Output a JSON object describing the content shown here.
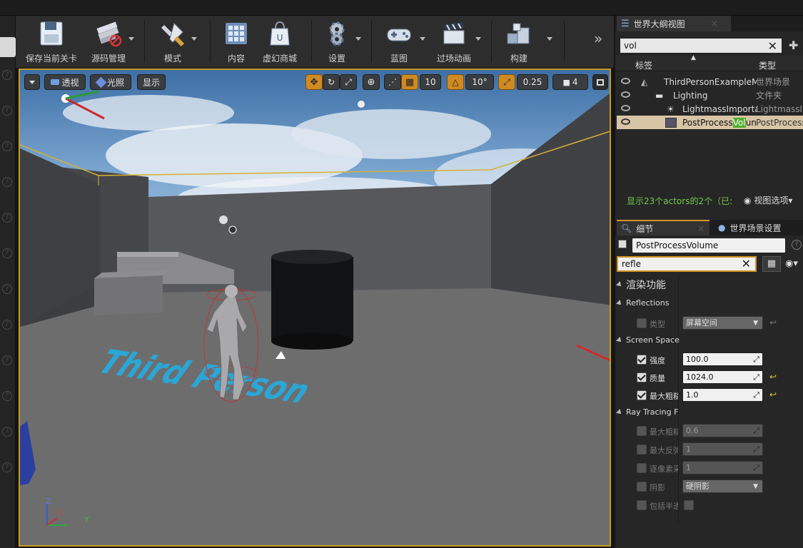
{
  "toolbar": {
    "buttons": [
      {
        "label": "保存当前关卡",
        "icon": "floppy-save-icon"
      },
      {
        "label": "源码管理",
        "icon": "source-control-icon"
      },
      {
        "label": "模式",
        "icon": "modes-tools-icon"
      },
      {
        "label": "内容",
        "icon": "content-grid-icon"
      },
      {
        "label": "虚幻商城",
        "icon": "marketplace-bag-icon"
      },
      {
        "label": "设置",
        "icon": "settings-gear-icon"
      },
      {
        "label": "蓝图",
        "icon": "blueprint-gamepad-icon"
      },
      {
        "label": "过场动画",
        "icon": "cinematics-clapper-icon"
      },
      {
        "label": "构建",
        "icon": "build-cubes-icon"
      }
    ],
    "more": "»"
  },
  "viewport": {
    "perspective_label": "透视",
    "lit_label": "光照",
    "show_label": "显示",
    "grid_snap": "10",
    "rotation_snap": "10°",
    "scale_snap": "0.25",
    "camera_speed": "4",
    "axis_z": "Z",
    "axis_x": "X",
    "axis_y": "Y",
    "floor_text": "Third Person"
  },
  "outliner": {
    "tab_label": "世界大纲视图",
    "search_value": "vol",
    "col_label": "标签",
    "col_type": "类型",
    "rows": [
      {
        "name": "ThirdPersonExampleM",
        "type": "世界场景"
      },
      {
        "name": "Lighting",
        "type": "文件夹"
      },
      {
        "name": "LightmassImporta",
        "type": "LightmassI"
      },
      {
        "name_pre": "PostProcess",
        "name_hl": "Vol",
        "name_post": "un",
        "type": "PostProcess"
      }
    ],
    "status": "显示23个actors的2个（已:",
    "view_options": "视图选项"
  },
  "details": {
    "tab_label": "细节",
    "world_settings_tab": "世界场景设置",
    "actor_name": "PostProcessVolume",
    "search_value": "refle",
    "category": "渲染功能",
    "sections": {
      "reflections": "Reflections",
      "screen_space": "Screen Space",
      "ray_tracing": "Ray Tracing F"
    },
    "props": {
      "type_label": "类型",
      "type_value": "屏幕空间",
      "intensity_label": "强度",
      "intensity_value": "100.0",
      "quality_label": "质量",
      "quality_value": "1024.0",
      "max_rough_label": "最大粗糙",
      "max_rough_value": "1.0",
      "rt_max_rough_label": "最大粗糙",
      "rt_max_rough_value": "0.6",
      "rt_max_bounce_label": "最大反弹",
      "rt_max_bounce_value": "1",
      "rt_spp_label": "逐像素采",
      "rt_spp_value": "1",
      "rt_shadow_label": "阴影",
      "rt_shadow_value": "硬阴影",
      "rt_translucent_label": "包括半透"
    }
  },
  "colors": {
    "accent_orange": "#d08a22",
    "selection_border": "#c89a20",
    "highlight_green": "#4fb02c",
    "arrow_red": "#e02020"
  }
}
